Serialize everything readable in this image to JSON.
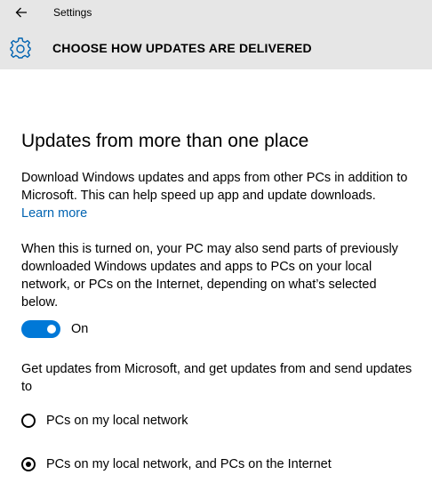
{
  "window": {
    "app_title": "Settings",
    "back_icon": "back-arrow-icon"
  },
  "header": {
    "icon": "gear-icon",
    "title": "CHOOSE HOW UPDATES ARE DELIVERED"
  },
  "main": {
    "section_title": "Updates from more than one place",
    "description": "Download Windows updates and apps from other PCs in addition to Microsoft. This can help speed up app and update downloads.",
    "learn_more": "Learn more",
    "sharing_note": "When this is turned on, your PC may also send parts of previously downloaded Windows updates and apps to PCs on your local network, or PCs on the Internet, depending on what’s selected below.",
    "toggle": {
      "state": "on",
      "label": "On",
      "color": "#0078d7"
    },
    "source_prompt": "Get updates from Microsoft, and get updates from and send updates to",
    "options": [
      {
        "label": "PCs on my local network",
        "selected": false
      },
      {
        "label": "PCs on my local network, and PCs on the Internet",
        "selected": true
      }
    ]
  },
  "colors": {
    "accent": "#0078d7",
    "link": "#0063b1",
    "header_bg": "#e6e6e6"
  }
}
